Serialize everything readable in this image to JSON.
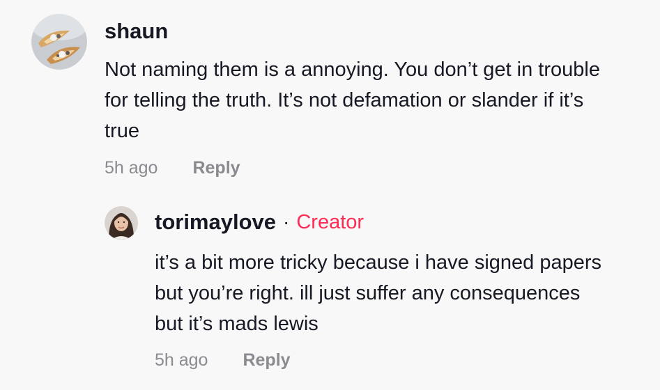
{
  "comment": {
    "username": "shaun",
    "text": "Not naming them is a annoying. You don’t get in trouble\nfor telling the truth. It’s not defamation or slander if it’s\ntrue",
    "timestamp": "5h ago",
    "reply_label": "Reply",
    "avatar_icon": "user-avatar-photo"
  },
  "reply": {
    "username": "torimaylove",
    "separator": "·",
    "badge": "Creator",
    "text": "it’s a bit more tricky because i have signed papers\nbut you’re right. ill just suffer any consequences\nbut it’s mads lewis",
    "timestamp": "5h ago",
    "reply_label": "Reply",
    "avatar_icon": "user-avatar-photo"
  },
  "colors": {
    "background": "#f8f8f8",
    "text": "#161823",
    "muted": "#8a8b91",
    "creator": "#fe2c55"
  }
}
